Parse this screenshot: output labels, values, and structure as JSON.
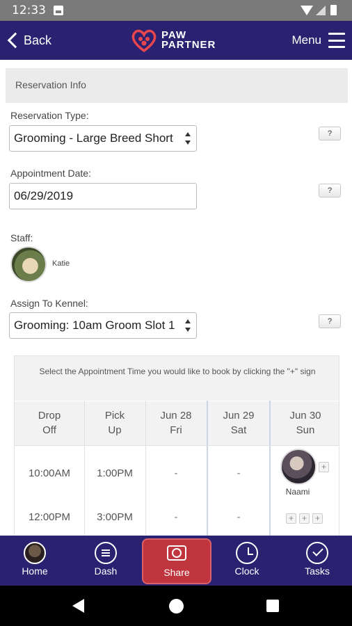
{
  "status_bar": {
    "time": "12:33"
  },
  "appbar": {
    "back_label": "Back",
    "logo_line1": "PAW",
    "logo_line2": "PARTNER",
    "menu_label": "Menu",
    "brand_color": "#2a2270",
    "accent_color": "#e8454d"
  },
  "reservation": {
    "section_title": "Reservation Info",
    "type_label": "Reservation Type:",
    "type_value": "Grooming - Large Breed Short",
    "date_label": "Appointment Date:",
    "date_value": "06/29/2019",
    "staff_label": "Staff:",
    "staff_name": "Katie",
    "kennel_label": "Assign To Kennel:",
    "kennel_value": "Grooming: 10am Groom Slot 1",
    "help_label": "?"
  },
  "schedule": {
    "note": "Select the Appointment Time you would like to book by clicking the \"+\" sign",
    "headers": [
      {
        "line1": "Drop",
        "line2": "Off"
      },
      {
        "line1": "Pick",
        "line2": "Up"
      },
      {
        "line1": "Jun 28",
        "line2": "Fri"
      },
      {
        "line1": "Jun 29",
        "line2": "Sat"
      },
      {
        "line1": "Jun 30",
        "line2": "Sun"
      }
    ],
    "rows": [
      {
        "drop_off": "10:00AM",
        "pick_up": "1:00PM",
        "fri": "-",
        "sat": "-",
        "sun_booked_by": "Naami"
      },
      {
        "drop_off": "12:00PM",
        "pick_up": "3:00PM",
        "fri": "-",
        "sat": "-"
      }
    ],
    "plus": "+"
  },
  "bottom_nav": {
    "items": [
      {
        "label": "Home",
        "icon": "avatar-icon"
      },
      {
        "label": "Dash",
        "icon": "dashboard-icon"
      },
      {
        "label": "Share",
        "icon": "camera-icon"
      },
      {
        "label": "Clock",
        "icon": "clock-icon"
      },
      {
        "label": "Tasks",
        "icon": "check-icon"
      }
    ],
    "active": "Share",
    "active_color": "#c0353d"
  }
}
